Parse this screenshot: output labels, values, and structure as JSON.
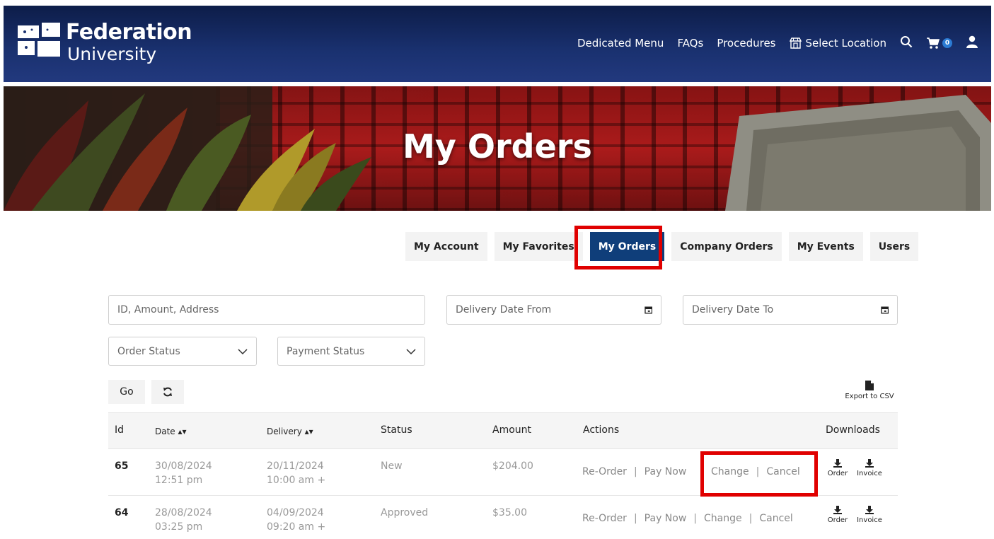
{
  "header": {
    "logo_line1": "Federation",
    "logo_line2": "University",
    "nav": {
      "dedicated_menu": "Dedicated Menu",
      "faqs": "FAQs",
      "procedures": "Procedures",
      "select_location": "Select Location",
      "cart_count": "0"
    }
  },
  "hero": {
    "title": "My Orders"
  },
  "tabs": [
    {
      "label": "My Account"
    },
    {
      "label": "My Favorites"
    },
    {
      "label": "My Orders",
      "active": true
    },
    {
      "label": "Company Orders"
    },
    {
      "label": "My Events"
    },
    {
      "label": "Users"
    }
  ],
  "filters": {
    "search_placeholder": "ID, Amount, Address",
    "delivery_from_placeholder": "Delivery Date From",
    "delivery_to_placeholder": "Delivery Date To",
    "order_status": "Order Status",
    "payment_status": "Payment Status",
    "go_label": "Go",
    "export_label": "Export to CSV"
  },
  "table": {
    "headers": {
      "id": "Id",
      "date": "Date",
      "delivery": "Delivery",
      "status": "Status",
      "amount": "Amount",
      "actions": "Actions",
      "downloads": "Downloads"
    },
    "rows": [
      {
        "id": "65",
        "date": "30/08/2024",
        "time": "12:51 pm",
        "delivery_date": "20/11/2024",
        "delivery_time": "10:00 am +",
        "status": "New",
        "amount": "$204.00",
        "actions": [
          "Re-Order",
          "Pay Now",
          "Change",
          "Cancel"
        ],
        "downloads": [
          "Order",
          "Invoice"
        ]
      },
      {
        "id": "64",
        "date": "28/08/2024",
        "time": "03:25 pm",
        "delivery_date": "04/09/2024",
        "delivery_time": "09:20 am +",
        "status": "Approved",
        "amount": "$35.00",
        "actions": [
          "Re-Order",
          "Pay Now",
          "Change",
          "Cancel"
        ],
        "downloads": [
          "Order",
          "Invoice"
        ]
      }
    ]
  },
  "colors": {
    "header_navy": "#1a3170",
    "active_tab": "#0f3e7a",
    "highlight_red": "#e00000"
  }
}
